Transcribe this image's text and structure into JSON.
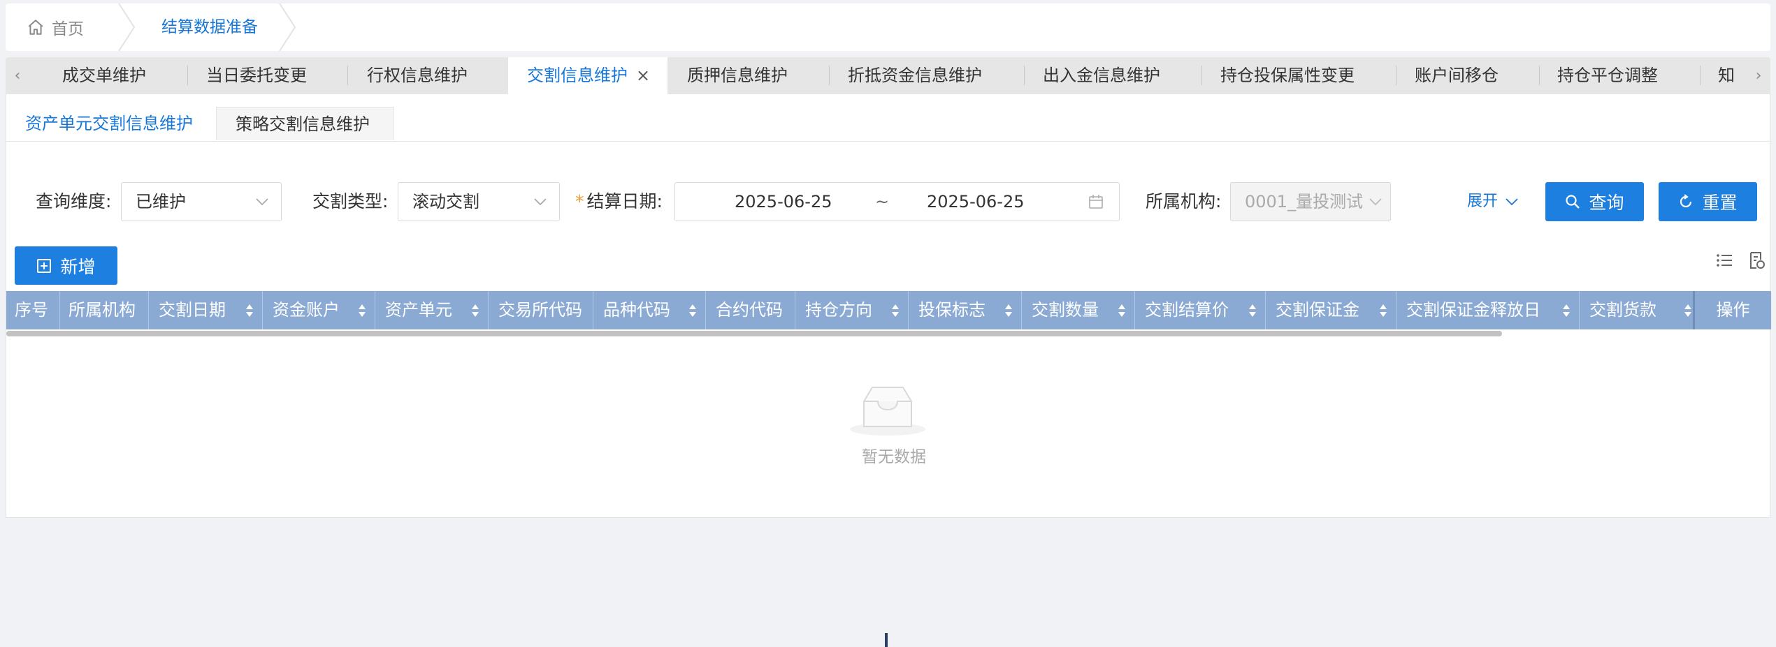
{
  "breadcrumb": {
    "home": "首页",
    "current": "结算数据准备"
  },
  "tabs": {
    "prev": "‹",
    "next": "›",
    "items": [
      "成交单维护",
      "当日委托变更",
      "行权信息维护",
      "交割信息维护",
      "质押信息维护",
      "折抵资金信息维护",
      "出入金信息维护",
      "持仓投保属性变更",
      "账户间移仓",
      "持仓平仓调整",
      "知"
    ],
    "close": "×"
  },
  "subtabs": [
    "资产单元交割信息维护",
    "策略交割信息维护"
  ],
  "filters": {
    "dimension_label": "查询维度:",
    "dimension_value": "已维护",
    "type_label": "交割类型:",
    "type_value": "滚动交割",
    "date_required": "*",
    "date_label": "结算日期:",
    "date_start": "2025-06-25",
    "date_sep": "~",
    "date_end": "2025-06-25",
    "org_label": "所属机构:",
    "org_value": "0001_量投测试",
    "expand": "展开",
    "query": "查询",
    "reset": "重置"
  },
  "actions": {
    "add": "新增"
  },
  "table": {
    "columns": [
      "序号",
      "所属机构",
      "交割日期",
      "资金账户",
      "资产单元",
      "交易所代码",
      "品种代码",
      "合约代码",
      "持仓方向",
      "投保标志",
      "交割数量",
      "交割结算价",
      "交割保证金",
      "交割保证金释放日",
      "交割货款"
    ],
    "operation": "操作",
    "empty": "暂无数据"
  },
  "colors": {
    "accent": "#1d7fe0",
    "header": "#8aaad4",
    "link": "#1677d8"
  }
}
